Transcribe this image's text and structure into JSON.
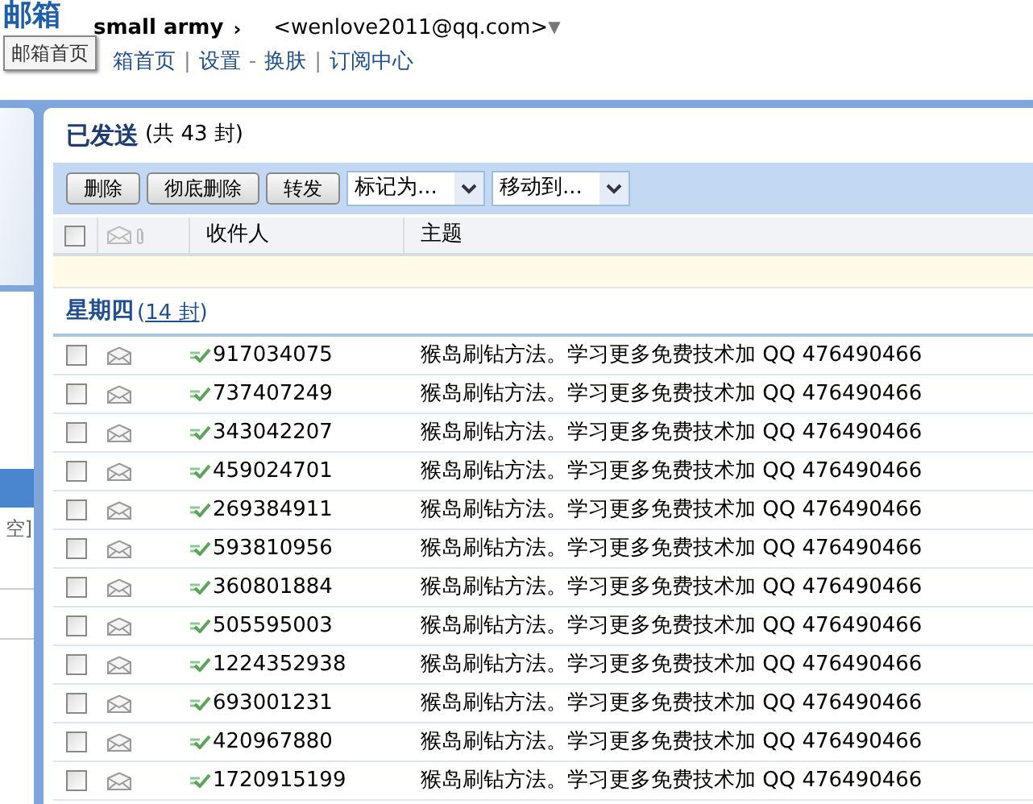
{
  "header": {
    "logo": "邮箱",
    "user_name": "small army",
    "user_caret": "›",
    "email": "<wenlove2011@qq.com>",
    "email_caret": "▼",
    "tooltip": "邮箱首页",
    "nav_links": [
      {
        "label": "箱首页",
        "sep": "|"
      },
      {
        "label": "设置",
        "sep": "-"
      },
      {
        "label": "换肤",
        "sep": "|"
      },
      {
        "label": "订阅中心"
      }
    ]
  },
  "sidebar": {
    "cut_text": "空]"
  },
  "folder": {
    "title": "已发送",
    "count": "(共 43 封)"
  },
  "toolbar": {
    "buttons": [
      "删除",
      "彻底删除",
      "转发"
    ],
    "dropdowns": [
      "标记为...",
      "移动到..."
    ]
  },
  "table": {
    "select_all_checked": false,
    "columns": [
      "收件人",
      "主题"
    ],
    "group": {
      "title": "星期四",
      "open": "(",
      "count": "14 封",
      "close": ")"
    },
    "rows": [
      {
        "recipient": "917034075",
        "subject": "猴岛刷钻方法。学习更多免费技术加 QQ 476490466",
        "checked": false
      },
      {
        "recipient": "737407249",
        "subject": "猴岛刷钻方法。学习更多免费技术加 QQ 476490466",
        "checked": false
      },
      {
        "recipient": "343042207",
        "subject": "猴岛刷钻方法。学习更多免费技术加 QQ 476490466",
        "checked": false
      },
      {
        "recipient": "459024701",
        "subject": "猴岛刷钻方法。学习更多免费技术加 QQ 476490466",
        "checked": false
      },
      {
        "recipient": "269384911",
        "subject": "猴岛刷钻方法。学习更多免费技术加 QQ 476490466",
        "checked": false
      },
      {
        "recipient": "593810956",
        "subject": "猴岛刷钻方法。学习更多免费技术加 QQ 476490466",
        "checked": false
      },
      {
        "recipient": "360801884",
        "subject": "猴岛刷钻方法。学习更多免费技术加 QQ 476490466",
        "checked": false
      },
      {
        "recipient": "505595003",
        "subject": "猴岛刷钻方法。学习更多免费技术加 QQ 476490466",
        "checked": false
      },
      {
        "recipient": "1224352938",
        "subject": "猴岛刷钻方法。学习更多免费技术加 QQ 476490466",
        "checked": false
      },
      {
        "recipient": "693001231",
        "subject": "猴岛刷钻方法。学习更多免费技术加 QQ 476490466",
        "checked": false
      },
      {
        "recipient": "420967880",
        "subject": "猴岛刷钻方法。学习更多免费技术加 QQ 476490466",
        "checked": false
      },
      {
        "recipient": "1720915199",
        "subject": "猴岛刷钻方法。学习更多免费技术加 QQ 476490466",
        "checked": false
      }
    ]
  }
}
